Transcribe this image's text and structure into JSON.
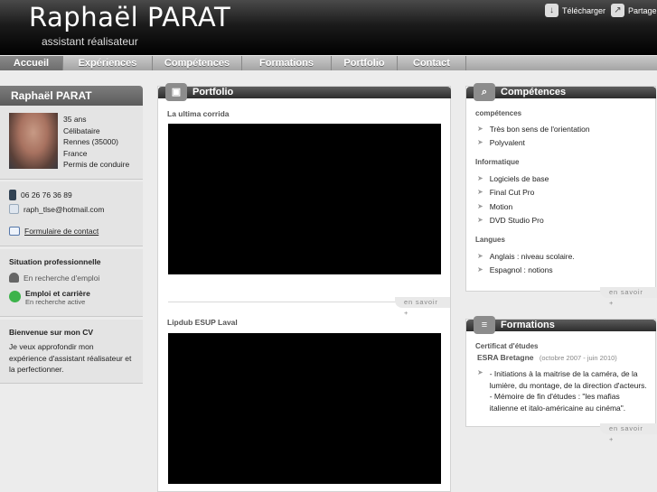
{
  "header": {
    "name": "Raphaël PARAT",
    "subtitle": "assistant réalisateur",
    "download_label": "Télécharger",
    "share_label": "Partager",
    "download_icon": "download-icon",
    "share_icon": "share-icon"
  },
  "nav": {
    "items": [
      {
        "label": "Accueil",
        "active": true
      },
      {
        "label": "Expériences",
        "active": false
      },
      {
        "label": "Compétences",
        "active": false
      },
      {
        "label": "Formations",
        "active": false
      },
      {
        "label": "Portfolio",
        "active": false
      },
      {
        "label": "Contact",
        "active": false
      }
    ]
  },
  "profile": {
    "title": "Raphaël PARAT",
    "age": "35 ans",
    "status": "Célibataire",
    "city": "Rennes (35000)",
    "country": "France",
    "license": "Permis de conduire",
    "phone": "06 26 76 36 89",
    "email": "raph_tlse@hotmail.com",
    "contact_form": "Formulaire de contact",
    "situation_title": "Situation professionnelle",
    "situation_search": "En recherche d'emploi",
    "emploi_title": "Emploi et carrière",
    "emploi_status": "En recherche active",
    "welcome_title": "Bienvenue sur mon CV",
    "welcome_text_1": "Je veux approfondir mon",
    "welcome_text_2": "expérience d'assistant réalisateur et",
    "welcome_text_3": "la perfectionner."
  },
  "portfolio": {
    "title": "Portfolio",
    "video1_title": "La ultima corrida",
    "video2_title": "Lipdub ESUP Laval",
    "more_label": "en savoir +"
  },
  "competences": {
    "title": "Compétences",
    "section1": "compétences",
    "items1": [
      "Très bon sens de l'orientation",
      "Polyvalent"
    ],
    "section2": "Informatique",
    "items2": [
      "Logiciels de base",
      "Final Cut Pro",
      "Motion",
      "DVD Studio Pro"
    ],
    "section3": "Langues",
    "items3": [
      "Anglais : niveau scolaire.",
      "Espagnol : notions"
    ],
    "more_label": "en savoir +"
  },
  "formations": {
    "title": "Formations",
    "cert_title": "Certificat d'études",
    "school": "ESRA Bretagne",
    "dates": "(octobre 2007 - juin 2010)",
    "desc_1": "- Initiations à la maitrise de la caméra, de la",
    "desc_2": "lumière, du montage, de la direction d'acteurs.",
    "desc_3": "- Mémoire de fin d'études : \"les mafias",
    "desc_4": "italienne et italo-américaine au cinéma\".",
    "more_label": "en savoir +"
  }
}
